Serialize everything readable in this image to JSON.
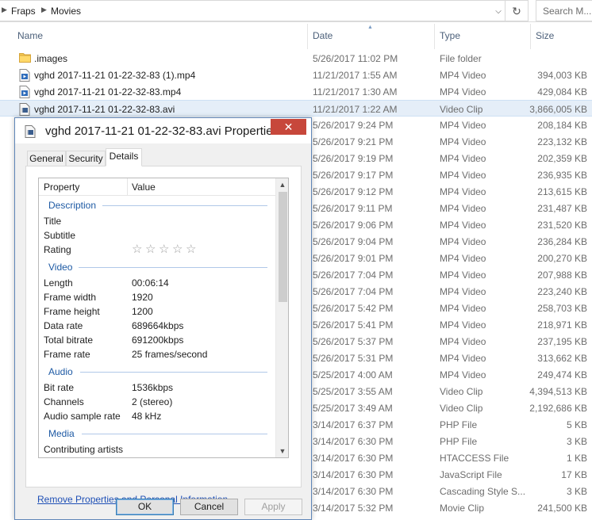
{
  "explorer": {
    "breadcrumb": [
      "Fraps",
      "Movies"
    ],
    "search_placeholder": "Search M...",
    "columns": {
      "name": "Name",
      "date": "Date",
      "type": "Type",
      "size": "Size"
    },
    "files": [
      {
        "name": ".images",
        "date": "5/26/2017 11:02 PM",
        "type": "File folder",
        "size": "",
        "icon": "folder-icon"
      },
      {
        "name": "vghd 2017-11-21 01-22-32-83 (1).mp4",
        "date": "11/21/2017 1:55 AM",
        "type": "MP4 Video",
        "size": "394,003 KB",
        "icon": "video-file-icon"
      },
      {
        "name": "vghd 2017-11-21 01-22-32-83.mp4",
        "date": "11/21/2017 1:30 AM",
        "type": "MP4 Video",
        "size": "429,084 KB",
        "icon": "video-file-icon"
      },
      {
        "name": "vghd 2017-11-21 01-22-32-83.avi",
        "date": "11/21/2017 1:22 AM",
        "type": "Video Clip",
        "size": "3,866,005 KB",
        "icon": "avi-file-icon",
        "selected": true
      },
      {
        "name": "",
        "date": "5/26/2017 9:24 PM",
        "type": "MP4 Video",
        "size": "208,184 KB"
      },
      {
        "name": "",
        "date": "5/26/2017 9:21 PM",
        "type": "MP4 Video",
        "size": "223,132 KB"
      },
      {
        "name": "",
        "date": "5/26/2017 9:19 PM",
        "type": "MP4 Video",
        "size": "202,359 KB"
      },
      {
        "name": "",
        "date": "5/26/2017 9:17 PM",
        "type": "MP4 Video",
        "size": "236,935 KB"
      },
      {
        "name": "",
        "date": "5/26/2017 9:12 PM",
        "type": "MP4 Video",
        "size": "213,615 KB"
      },
      {
        "name": "",
        "date": "5/26/2017 9:11 PM",
        "type": "MP4 Video",
        "size": "231,487 KB"
      },
      {
        "name": "",
        "date": "5/26/2017 9:06 PM",
        "type": "MP4 Video",
        "size": "231,520 KB"
      },
      {
        "name": "",
        "date": "5/26/2017 9:04 PM",
        "type": "MP4 Video",
        "size": "236,284 KB"
      },
      {
        "name": "",
        "date": "5/26/2017 9:01 PM",
        "type": "MP4 Video",
        "size": "200,270 KB"
      },
      {
        "name": "",
        "date": "5/26/2017 7:04 PM",
        "type": "MP4 Video",
        "size": "207,988 KB"
      },
      {
        "name": "",
        "date": "5/26/2017 7:04 PM",
        "type": "MP4 Video",
        "size": "223,240 KB"
      },
      {
        "name": "",
        "date": "5/26/2017 5:42 PM",
        "type": "MP4 Video",
        "size": "258,703 KB"
      },
      {
        "name": "",
        "date": "5/26/2017 5:41 PM",
        "type": "MP4 Video",
        "size": "218,971 KB"
      },
      {
        "name": "",
        "date": "5/26/2017 5:37 PM",
        "type": "MP4 Video",
        "size": "237,195 KB"
      },
      {
        "name": "",
        "date": "5/26/2017 5:31 PM",
        "type": "MP4 Video",
        "size": "313,662 KB"
      },
      {
        "name": "",
        "date": "5/25/2017 4:00 AM",
        "type": "MP4 Video",
        "size": "249,474 KB"
      },
      {
        "name": "",
        "date": "5/25/2017 3:55 AM",
        "type": "Video Clip",
        "size": "4,394,513 KB"
      },
      {
        "name": "",
        "date": "5/25/2017 3:49 AM",
        "type": "Video Clip",
        "size": "2,192,686 KB"
      },
      {
        "name": "",
        "date": "3/14/2017 6:37 PM",
        "type": "PHP File",
        "size": "5 KB"
      },
      {
        "name": "",
        "date": "3/14/2017 6:30 PM",
        "type": "PHP File",
        "size": "3 KB"
      },
      {
        "name": "",
        "date": "3/14/2017 6:30 PM",
        "type": "HTACCESS File",
        "size": "1 KB"
      },
      {
        "name": "",
        "date": "3/14/2017 6:30 PM",
        "type": "JavaScript File",
        "size": "17 KB"
      },
      {
        "name": "",
        "date": "3/14/2017 6:30 PM",
        "type": "Cascading Style S...",
        "size": "3 KB"
      },
      {
        "name": "",
        "date": "3/14/2017 5:32 PM",
        "type": "Movie Clip",
        "size": "241,500 KB"
      }
    ]
  },
  "dialog": {
    "title": "vghd 2017-11-21 01-22-32-83.avi Properties",
    "close_label": "✕",
    "tabs": [
      "General",
      "Security",
      "Details"
    ],
    "active_tab": "Details",
    "list_header": {
      "property": "Property",
      "value": "Value"
    },
    "groups": {
      "description": "Description",
      "video": "Video",
      "audio": "Audio",
      "media": "Media"
    },
    "description_props": [
      {
        "name": "Title",
        "value": ""
      },
      {
        "name": "Subtitle",
        "value": ""
      },
      {
        "name": "Rating",
        "value": ""
      }
    ],
    "rating_stars": 0,
    "video_props": [
      {
        "name": "Length",
        "value": "00:06:14"
      },
      {
        "name": "Frame width",
        "value": "1920"
      },
      {
        "name": "Frame height",
        "value": "1200"
      },
      {
        "name": "Data rate",
        "value": "689664kbps"
      },
      {
        "name": "Total bitrate",
        "value": "691200kbps"
      },
      {
        "name": "Frame rate",
        "value": "25 frames/second"
      }
    ],
    "audio_props": [
      {
        "name": "Bit rate",
        "value": "1536kbps"
      },
      {
        "name": "Channels",
        "value": "2 (stereo)"
      },
      {
        "name": "Audio sample rate",
        "value": "48 kHz"
      }
    ],
    "media_props": [
      {
        "name": "Contributing artists",
        "value": ""
      }
    ],
    "remove_link": "Remove Properties and Personal Information",
    "buttons": {
      "ok": "OK",
      "cancel": "Cancel",
      "apply": "Apply"
    }
  }
}
